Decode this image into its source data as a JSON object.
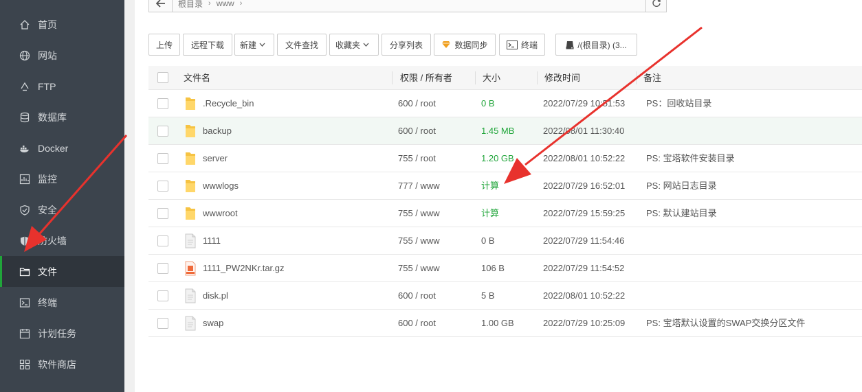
{
  "sidebar": {
    "items": [
      {
        "label": "首页",
        "icon": "home-icon"
      },
      {
        "label": "网站",
        "icon": "globe-icon"
      },
      {
        "label": "FTP",
        "icon": "ftp-icon"
      },
      {
        "label": "数据库",
        "icon": "database-icon"
      },
      {
        "label": "Docker",
        "icon": "docker-icon"
      },
      {
        "label": "监控",
        "icon": "monitor-icon"
      },
      {
        "label": "安全",
        "icon": "shield-icon"
      },
      {
        "label": "防火墙",
        "icon": "firewall-icon"
      },
      {
        "label": "文件",
        "icon": "folder-icon"
      },
      {
        "label": "终端",
        "icon": "terminal-icon"
      },
      {
        "label": "计划任务",
        "icon": "calendar-icon"
      },
      {
        "label": "软件商店",
        "icon": "grid-icon"
      }
    ],
    "active": "文件"
  },
  "path": {
    "crumbs": [
      "根目录",
      "www"
    ]
  },
  "toolbar": {
    "upload": "上传",
    "remote_download": "远程下载",
    "new": "新建",
    "file_search": "文件查找",
    "favorites": "收藏夹",
    "share_list": "分享列表",
    "data_sync": "数据同步",
    "terminal": "终端",
    "disk": "/(根目录) (3..."
  },
  "table": {
    "headers": {
      "name": "文件名",
      "perm": "权限 / 所有者",
      "size": "大小",
      "mtime": "修改时间",
      "note": "备注"
    },
    "rows": [
      {
        "name": ".Recycle_bin",
        "type": "folder",
        "perm": "600 / root",
        "size": "0 B",
        "mtime": "2022/07/29 10:51:53",
        "note": "PS：回收站目录"
      },
      {
        "name": "backup",
        "type": "folder",
        "perm": "600 / root",
        "size": "1.45 MB",
        "mtime": "2022/08/01 11:30:40",
        "note": ""
      },
      {
        "name": "server",
        "type": "folder",
        "perm": "755 / root",
        "size": "1.20 GB",
        "mtime": "2022/08/01 10:52:22",
        "note": "PS: 宝塔软件安装目录"
      },
      {
        "name": "wwwlogs",
        "type": "folder",
        "perm": "777 / www",
        "size": "计算",
        "mtime": "2022/07/29 16:52:01",
        "note": "PS: 网站日志目录"
      },
      {
        "name": "wwwroot",
        "type": "folder",
        "perm": "755 / www",
        "size": "计算",
        "mtime": "2022/07/29 15:59:25",
        "note": "PS: 默认建站目录"
      },
      {
        "name": "1111",
        "type": "file",
        "perm": "755 / www",
        "size": "0 B",
        "mtime": "2022/07/29 11:54:46",
        "note": ""
      },
      {
        "name": "1111_PW2NKr.tar.gz",
        "type": "archive",
        "perm": "755 / www",
        "size": "106 B",
        "mtime": "2022/07/29 11:54:52",
        "note": ""
      },
      {
        "name": "disk.pl",
        "type": "file",
        "perm": "600 / root",
        "size": "5 B",
        "mtime": "2022/08/01 10:52:22",
        "note": ""
      },
      {
        "name": "swap",
        "type": "file",
        "perm": "600 / root",
        "size": "1.00 GB",
        "mtime": "2022/07/29 10:25:09",
        "note": "PS: 宝塔默认设置的SWAP交换分区文件"
      }
    ]
  },
  "colors": {
    "sidebar_bg": "#3c444d",
    "accent_green": "#20a53a",
    "annotation_red": "#e8322d"
  }
}
